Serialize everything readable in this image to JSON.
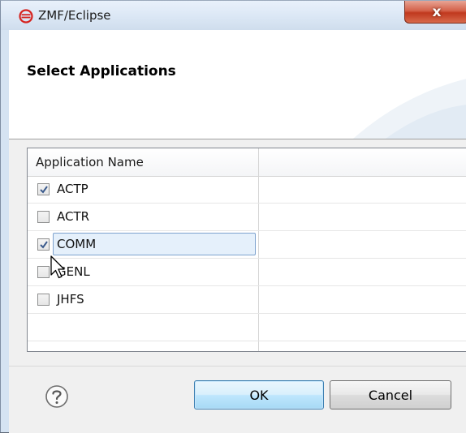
{
  "window": {
    "title": "ZMF/Eclipse",
    "app_icon": "eclipse-logo-icon",
    "close_label": "x"
  },
  "banner": {
    "title": "Select Applications"
  },
  "table": {
    "column_header": "Application Name",
    "rows": [
      {
        "name": "ACTP",
        "checked": true,
        "selected": false
      },
      {
        "name": "ACTR",
        "checked": false,
        "selected": false
      },
      {
        "name": "COMM",
        "checked": true,
        "selected": true
      },
      {
        "name": "GENL",
        "checked": false,
        "selected": false
      },
      {
        "name": "JHFS",
        "checked": false,
        "selected": false
      }
    ]
  },
  "footer": {
    "help_icon": "help-question-icon",
    "ok_label": "OK",
    "cancel_label": "Cancel"
  },
  "colors": {
    "accent": "#3c7fb1",
    "close_red": "#c0381e",
    "eclipse_red": "#d6231f"
  }
}
